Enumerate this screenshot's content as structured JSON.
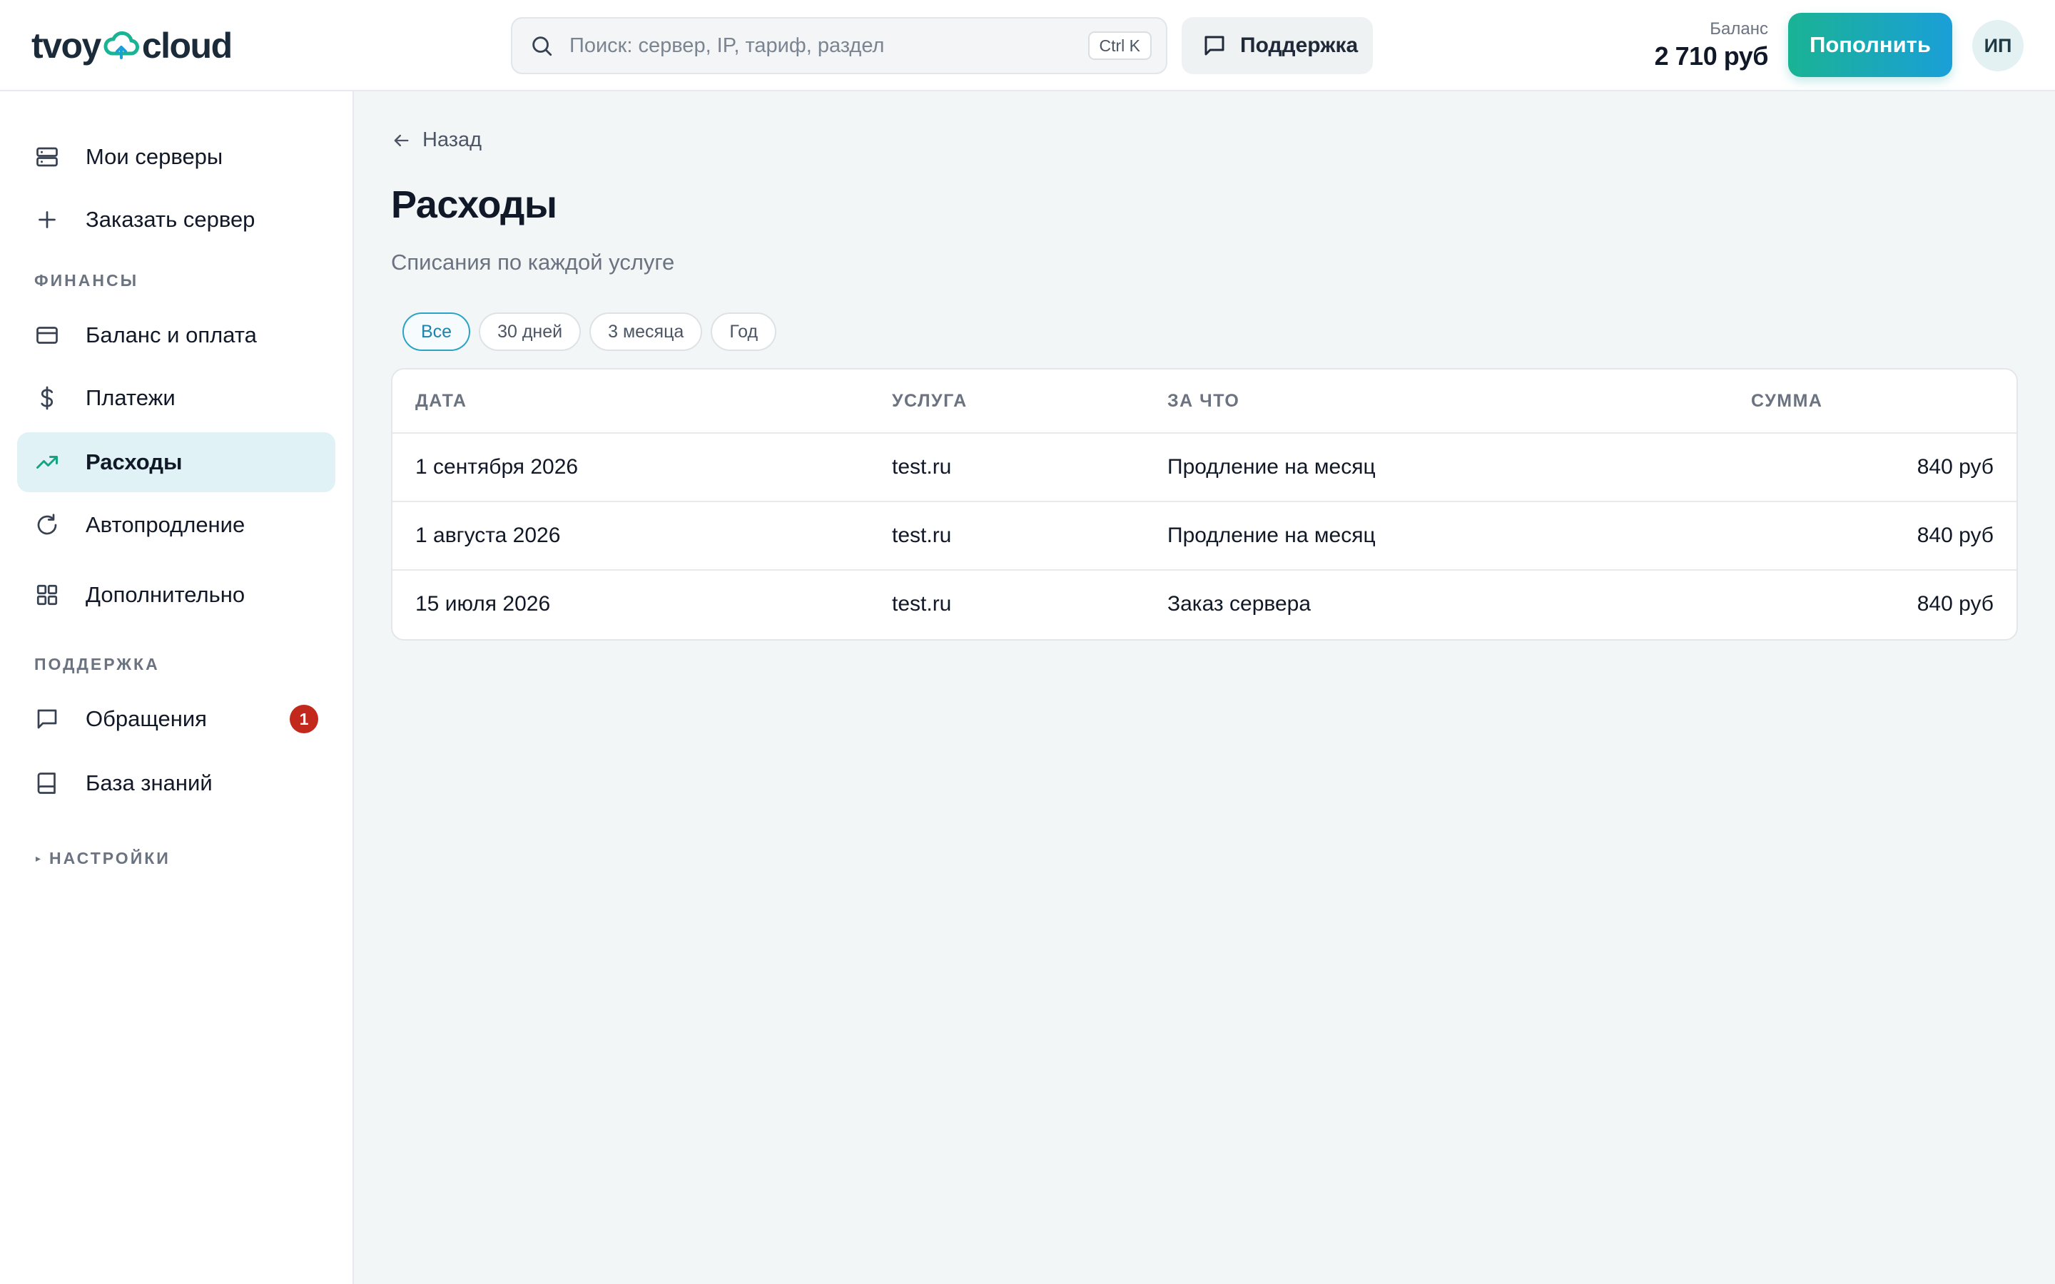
{
  "brand": {
    "left": "tvoy",
    "right": "cloud",
    "accent": "#1ab394"
  },
  "header": {
    "search_placeholder": "Поиск: сервер, IP, тариф, раздел",
    "search_shortcut": "Ctrl K",
    "support_label": "Поддержка",
    "balance_label": "Баланс",
    "balance_value": "2 710 руб",
    "topup_label": "Пополнить",
    "avatar_initials": "ИП"
  },
  "sidebar": {
    "items_top": [
      {
        "label": "Мои серверы",
        "icon": "server-icon"
      },
      {
        "label": "Заказать сервер",
        "icon": "plus-icon"
      }
    ],
    "finance_title": "ФИНАНСЫ",
    "finance_items": [
      {
        "label": "Баланс и оплата",
        "icon": "credit-card-icon"
      },
      {
        "label": "Платежи",
        "icon": "dollar-icon"
      },
      {
        "label": "Расходы",
        "icon": "trending-up-icon",
        "active": true
      },
      {
        "label": "Автопродление",
        "icon": "refresh-icon"
      },
      {
        "label": "Дополнительно",
        "icon": "grid-icon"
      }
    ],
    "support_title": "ПОДДЕРЖКА",
    "support_items": [
      {
        "label": "Обращения",
        "icon": "message-icon",
        "badge": "1"
      },
      {
        "label": "База знаний",
        "icon": "book-icon"
      }
    ],
    "settings_title": "НАСТРОЙКИ",
    "settings_toggle": "▸"
  },
  "main": {
    "back_label": "Назад",
    "title": "Расходы",
    "subtitle": "Списания по каждой услуге",
    "filters": [
      "Все",
      "30 дней",
      "3 месяца",
      "Год"
    ],
    "active_filter": "Все",
    "table": {
      "headers": [
        "ДАТА",
        "УСЛУГА",
        "ЗА ЧТО",
        "СУММА"
      ],
      "rows": [
        [
          "1 сентября 2026",
          "test.ru",
          "Продление на месяц",
          "840 руб"
        ],
        [
          "1 августа 2026",
          "test.ru",
          "Продление на месяц",
          "840 руб"
        ],
        [
          "15 июля 2026",
          "test.ru",
          "Заказ сервера",
          "840 руб"
        ]
      ]
    }
  }
}
